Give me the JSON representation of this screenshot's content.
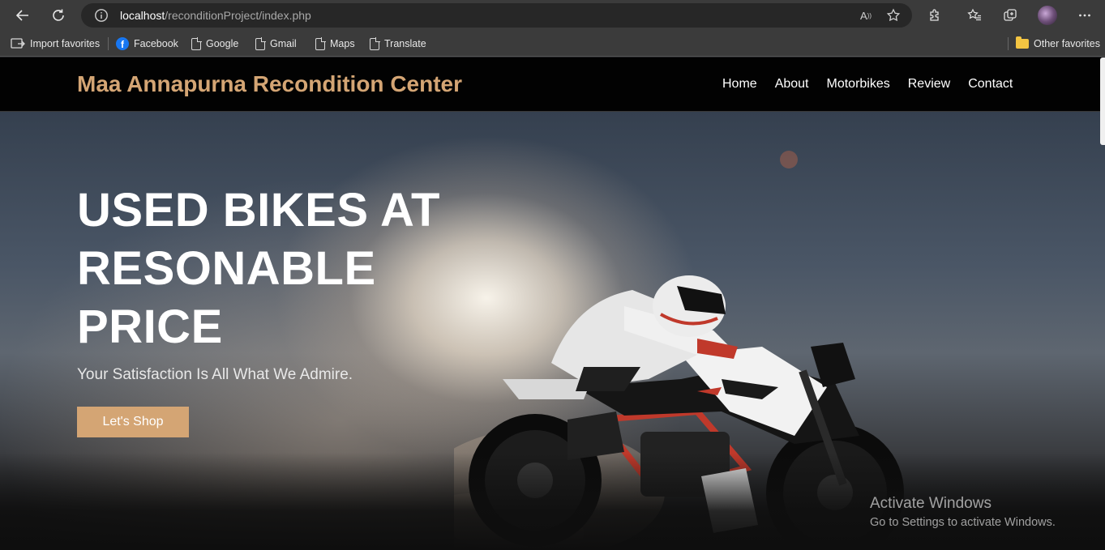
{
  "browser": {
    "address": {
      "host": "localhost",
      "path": "/reconditionProject/index.php"
    },
    "bookmarks": [
      {
        "label": "Import favorites",
        "icon": "import-icon"
      },
      {
        "label": "Facebook",
        "icon": "facebook-icon"
      },
      {
        "label": "Google",
        "icon": "page-icon"
      },
      {
        "label": "Gmail",
        "icon": "page-icon"
      },
      {
        "label": "Maps",
        "icon": "page-icon"
      },
      {
        "label": "Translate",
        "icon": "page-icon"
      }
    ],
    "other_favorites": "Other favorites"
  },
  "site": {
    "brand": "Maa Annapurna Recondition Center",
    "brand_color": "#d4a574",
    "nav": [
      "Home",
      "About",
      "Motorbikes",
      "Review",
      "Contact"
    ]
  },
  "hero": {
    "title": "USED BIKES AT RESONABLE PRICE",
    "subtitle": "Your Satisfaction Is All What We Admire.",
    "cta": "Let's Shop"
  },
  "os_watermark": {
    "title": "Activate Windows",
    "subtitle": "Go to Settings to activate Windows."
  }
}
